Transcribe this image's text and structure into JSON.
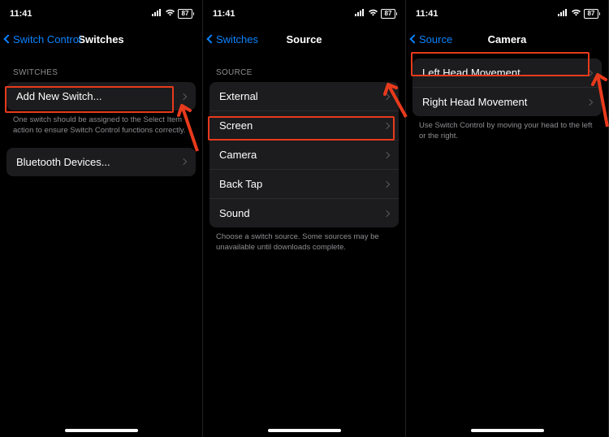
{
  "status": {
    "time": "11:41",
    "battery": "87"
  },
  "phones": [
    {
      "back": "Switch Control",
      "title": "Switches",
      "section1_header": "SWITCHES",
      "add_switch": "Add New Switch...",
      "add_switch_note": "One switch should be assigned to the Select Item action to ensure Switch Control functions correctly.",
      "bluetooth": "Bluetooth Devices..."
    },
    {
      "back": "Switches",
      "title": "Source",
      "section_header": "SOURCE",
      "items": [
        "External",
        "Screen",
        "Camera",
        "Back Tap",
        "Sound"
      ],
      "note": "Choose a switch source. Some sources may be unavailable until downloads complete."
    },
    {
      "back": "Source",
      "title": "Camera",
      "items": [
        "Left Head Movement",
        "Right Head Movement"
      ],
      "note": "Use Switch Control by moving your head to the left or the right."
    }
  ]
}
